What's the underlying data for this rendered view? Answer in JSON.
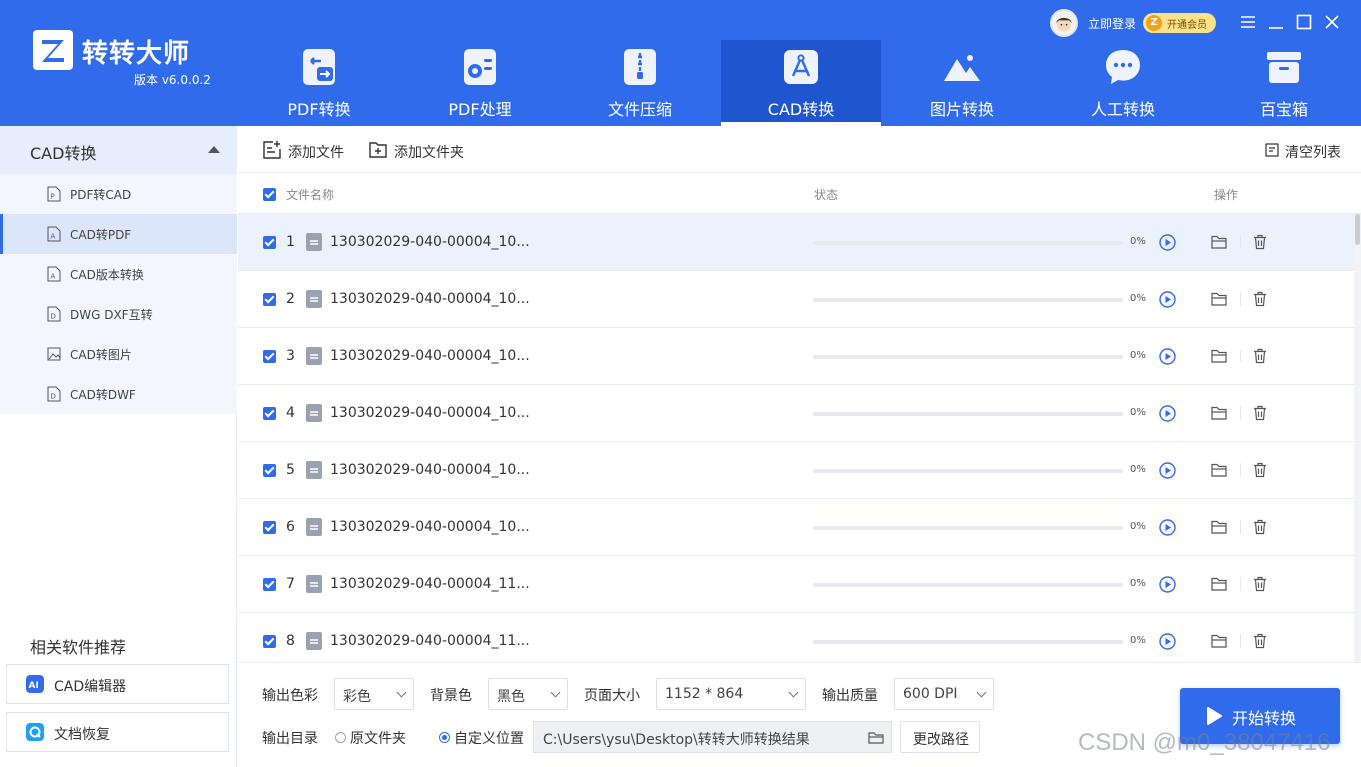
{
  "app": {
    "name": "转转大师",
    "version": "版本 v6.0.0.2",
    "login_label": "立即登录",
    "vip_label": "开通会员",
    "logo_letter": "Z",
    "accent_color": "#2f6bea"
  },
  "nav": {
    "tabs": [
      {
        "label": "PDF转换",
        "icon": "pdf-convert-icon"
      },
      {
        "label": "PDF处理",
        "icon": "pdf-process-icon"
      },
      {
        "label": "文件压缩",
        "icon": "zip-icon"
      },
      {
        "label": "CAD转换",
        "icon": "cad-icon",
        "active": true
      },
      {
        "label": "图片转换",
        "icon": "image-icon"
      },
      {
        "label": "人工转换",
        "icon": "chat-icon"
      },
      {
        "label": "百宝箱",
        "icon": "toolbox-icon"
      }
    ]
  },
  "sidebar": {
    "group_title": "CAD转换",
    "items": [
      {
        "label": "PDF转CAD"
      },
      {
        "label": "CAD转PDF",
        "active": true
      },
      {
        "label": "CAD版本转换"
      },
      {
        "label": "DWG DXF互转"
      },
      {
        "label": "CAD转图片"
      },
      {
        "label": "CAD转DWF"
      }
    ],
    "recommend_title": "相关软件推荐",
    "recommend": [
      {
        "label": "CAD编辑器",
        "icon_text": "AI"
      },
      {
        "label": "文档恢复"
      }
    ]
  },
  "toolbar": {
    "add_file": "添加文件",
    "add_folder": "添加文件夹",
    "clear_list": "清空列表"
  },
  "table": {
    "col_name": "文件名称",
    "col_status": "状态",
    "col_action": "操作",
    "rows": [
      {
        "num": "1",
        "name": "130302029-040-00004_10...",
        "progress": 0,
        "pct": "0%",
        "selected": true
      },
      {
        "num": "2",
        "name": "130302029-040-00004_10...",
        "progress": 0,
        "pct": "0%"
      },
      {
        "num": "3",
        "name": "130302029-040-00004_10...",
        "progress": 0,
        "pct": "0%"
      },
      {
        "num": "4",
        "name": "130302029-040-00004_10...",
        "progress": 0,
        "pct": "0%"
      },
      {
        "num": "5",
        "name": "130302029-040-00004_10...",
        "progress": 0,
        "pct": "0%"
      },
      {
        "num": "6",
        "name": "130302029-040-00004_10...",
        "progress": 0,
        "pct": "0%"
      },
      {
        "num": "7",
        "name": "130302029-040-00004_11...",
        "progress": 0,
        "pct": "0%"
      },
      {
        "num": "8",
        "name": "130302029-040-00004_11...",
        "progress": 0,
        "pct": "0%"
      }
    ]
  },
  "settings": {
    "color_label": "输出色彩",
    "color_value": "彩色",
    "bg_label": "背景色",
    "bg_value": "黑色",
    "size_label": "页面大小",
    "size_value": "1152 * 864",
    "quality_label": "输出质量",
    "quality_value": "600 DPI",
    "dir_label": "输出目录",
    "opt_original": "原文件夹",
    "opt_custom": "自定义位置",
    "path_value": "C:\\Users\\ysu\\Desktop\\转转大师转换结果",
    "change_path": "更改路径",
    "start": "开始转换"
  },
  "watermark": "CSDN @m0_38047416"
}
